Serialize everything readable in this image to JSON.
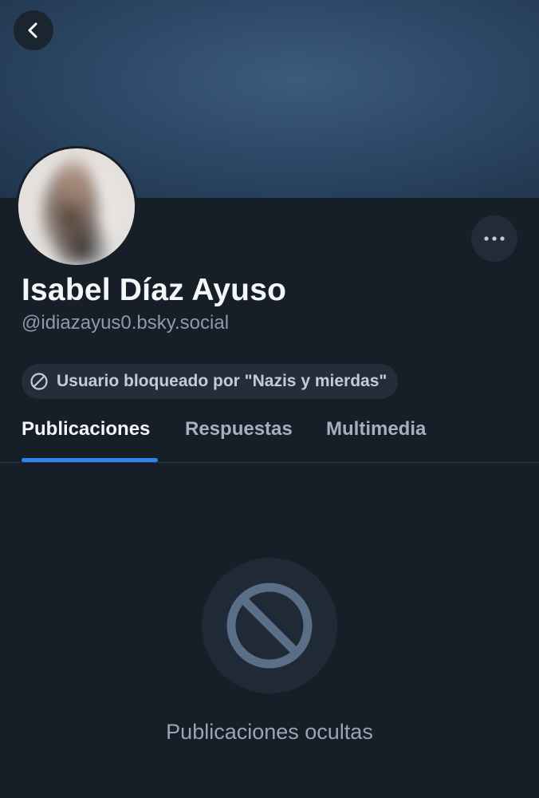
{
  "profile": {
    "display_name": "Isabel Díaz Ayuso",
    "handle": "@idiazayus0.bsky.social"
  },
  "moderation": {
    "blocked_label": "Usuario bloqueado por \"Nazis y mierdas\"",
    "icon": "prohibited-icon"
  },
  "tabs": [
    {
      "label": "Publicaciones",
      "active": true
    },
    {
      "label": "Respuestas",
      "active": false
    },
    {
      "label": "Multimedia",
      "active": false
    }
  ],
  "empty_state": {
    "icon": "prohibited-icon",
    "message": "Publicaciones ocultas"
  },
  "icons": {
    "back": "chevron-left-icon",
    "more": "ellipsis-icon"
  },
  "colors": {
    "background": "#161e27",
    "accent": "#2c86f0",
    "banner": "#2f4b6a"
  }
}
